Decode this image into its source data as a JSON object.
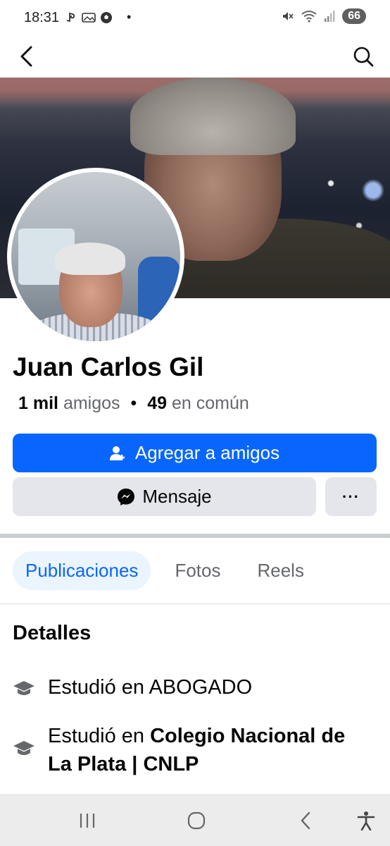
{
  "status_bar": {
    "time": "18:31",
    "battery": "66",
    "left_icons": [
      "playstation-icon",
      "gallery-icon",
      "soccer-ball-icon",
      "dot-icon"
    ],
    "right_icons": [
      "mute-icon",
      "wifi-icon",
      "signal-icon"
    ]
  },
  "app_bar": {
    "back_icon": "back-arrow-icon",
    "search_icon": "search-icon"
  },
  "profile": {
    "name": "Juan Carlos Gil",
    "friends_count": "1 mil",
    "friends_label": "amigos",
    "separator": "•",
    "mutual_count": "49",
    "mutual_label": "en común"
  },
  "actions": {
    "add_friend_label": "Agregar a amigos",
    "message_label": "Mensaje",
    "more_label": "···"
  },
  "tabs": [
    {
      "label": "Publicaciones",
      "active": true
    },
    {
      "label": "Fotos",
      "active": false
    },
    {
      "label": "Reels",
      "active": false
    }
  ],
  "details": {
    "title": "Detalles",
    "items": [
      {
        "prefix": "Estudió en ",
        "value": "ABOGADO",
        "value_bold": false
      },
      {
        "prefix": "Estudió en ",
        "value": "Colegio Nacional de La Plata | CNLP",
        "value_bold": true
      }
    ]
  },
  "colors": {
    "primary": "#0866ff",
    "secondary_button": "#e4e6eb",
    "muted_text": "#65676b",
    "active_tab_bg": "#ebf5ff"
  }
}
